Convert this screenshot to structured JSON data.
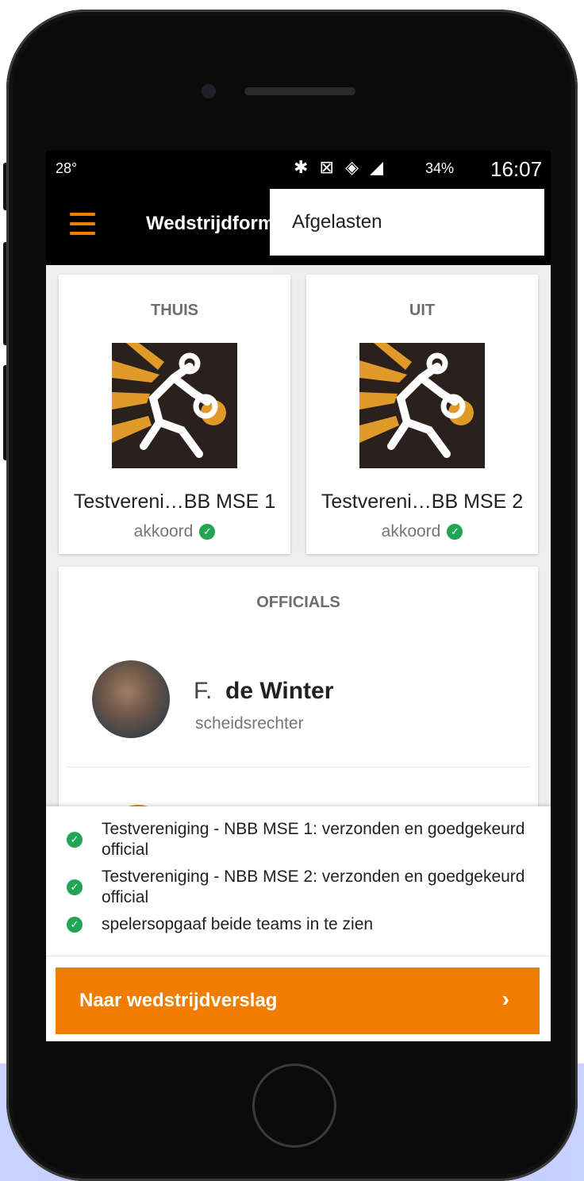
{
  "status_bar": {
    "temperature": "28°",
    "icons": "✱ ⊠ ◈ ◢",
    "battery_level": "34%",
    "time": "16:07"
  },
  "app_bar": {
    "title": "Wedstrijdformulier"
  },
  "overflow_menu": {
    "items": [
      "Afgelasten"
    ]
  },
  "teams": {
    "home": {
      "label": "THUIS",
      "name": "Testvereni…BB MSE 1",
      "status": "akkoord"
    },
    "away": {
      "label": "UIT",
      "name": "Testvereni…BB MSE 2",
      "status": "akkoord"
    }
  },
  "officials": {
    "label": "OFFICIALS",
    "list": [
      {
        "initial": "F.",
        "surname": "de Winter",
        "role": "scheidsrechter"
      }
    ]
  },
  "status_messages": [
    "Testvereniging - NBB MSE 1: verzonden en goedgekeurd official",
    "Testvereniging - NBB MSE 2: verzonden en goedgekeurd official",
    "spelersopgaaf beide teams in te zien"
  ],
  "cta": {
    "label": "Naar wedstrijdverslag",
    "chevron": "›"
  },
  "colors": {
    "accent": "#f07d00",
    "success": "#22a455",
    "logo_bg": "#2a201c",
    "logo_gold": "#e09a2a"
  }
}
